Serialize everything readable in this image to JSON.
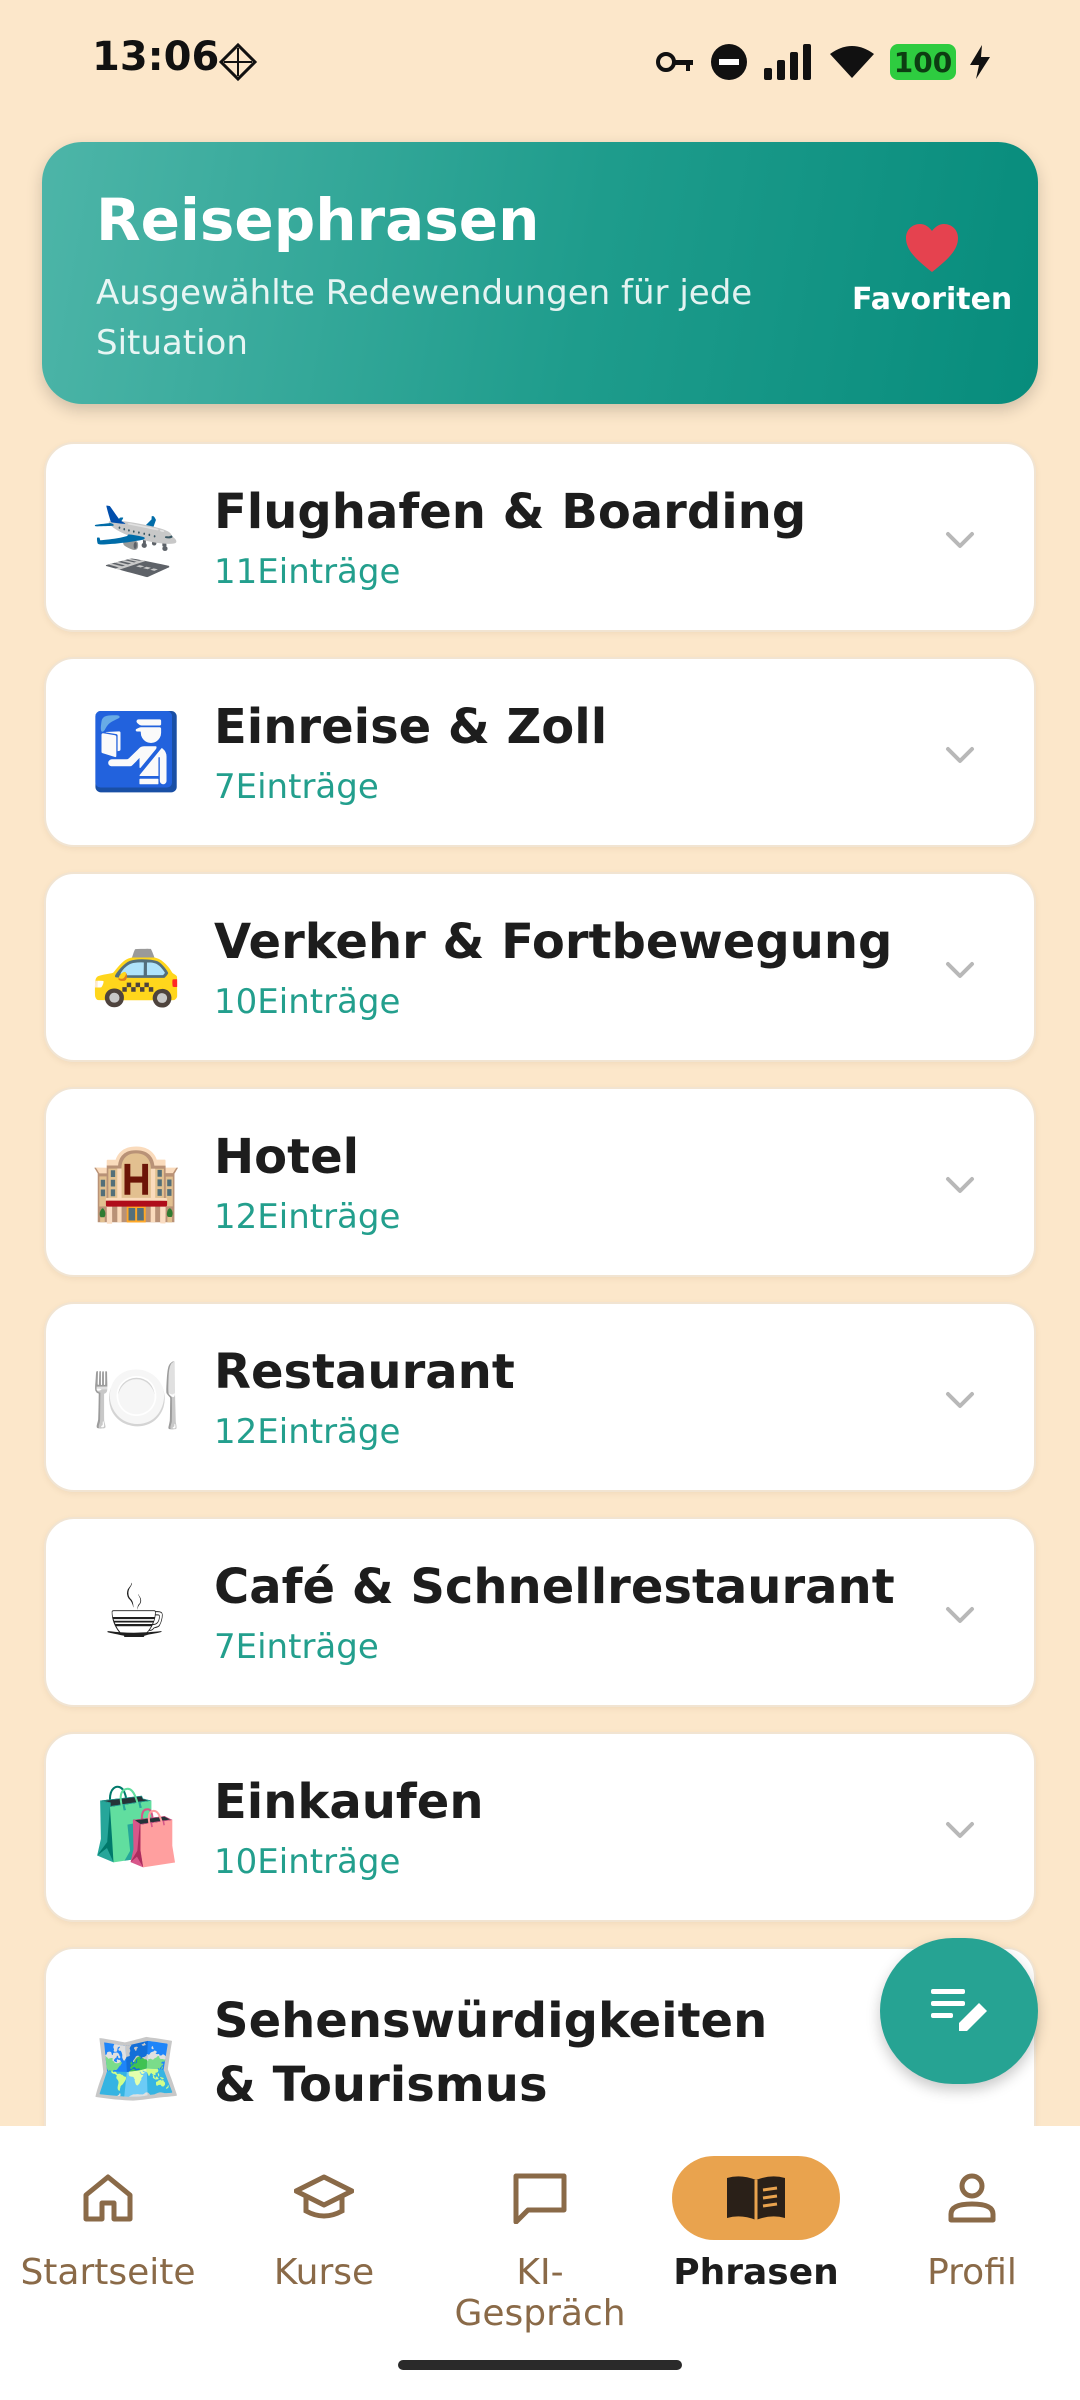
{
  "status_bar": {
    "time": "13:06",
    "battery": "100",
    "icons": [
      "diamond-grid-icon",
      "key-icon",
      "dnd-icon",
      "signal-icon",
      "wifi-icon",
      "battery-icon"
    ]
  },
  "header": {
    "title": "Reisephrasen",
    "subtitle": "Ausgewählte Redewendungen für jede Situation",
    "favorites_label": "Favoriten",
    "gradient": [
      "#4DB5A8",
      "#078C7C"
    ]
  },
  "categories": [
    {
      "emoji": "🛬",
      "icon_name": "airplane-icon",
      "title": "Flughafen & Boarding",
      "count": "11Einträge"
    },
    {
      "emoji": "🛂",
      "icon_name": "passport-control-icon",
      "title": "Einreise & Zoll",
      "count": "7Einträge"
    },
    {
      "emoji": "🚕",
      "icon_name": "taxi-icon",
      "title": "Verkehr & Fortbewegung",
      "count": "10Einträge"
    },
    {
      "emoji": "🏨",
      "icon_name": "hotel-icon",
      "title": "Hotel",
      "count": "12Einträge"
    },
    {
      "emoji": "🍽️",
      "icon_name": "plate-cutlery-icon",
      "title": "Restaurant",
      "count": "12Einträge"
    },
    {
      "emoji": "☕",
      "icon_name": "coffee-icon",
      "title": "Café & Schnellrestaurant",
      "count": "7Einträge"
    },
    {
      "emoji": "🛍️",
      "icon_name": "shopping-bags-icon",
      "title": "Einkaufen",
      "count": "10Einträge"
    },
    {
      "emoji": "🗺️",
      "icon_name": "world-map-icon",
      "title": "Sehenswürdigkeiten & Tourismus",
      "count": ""
    }
  ],
  "nav": [
    {
      "label": "Startseite",
      "icon_name": "home-icon",
      "active": false
    },
    {
      "label": "Kurse",
      "icon_name": "graduation-cap-icon",
      "active": false
    },
    {
      "label": "KI-Gespräch",
      "icon_name": "chat-bubble-icon",
      "active": false
    },
    {
      "label": "Phrasen",
      "icon_name": "book-icon",
      "active": true
    },
    {
      "label": "Profil",
      "icon_name": "person-icon",
      "active": false
    }
  ],
  "colors": {
    "background": "#FCE7CA",
    "accent": "#26A393",
    "count_text": "#239F8D",
    "nav_active": "#E9A34E",
    "heart": "#E5424F"
  },
  "fab_icon": "edit-notes-icon"
}
